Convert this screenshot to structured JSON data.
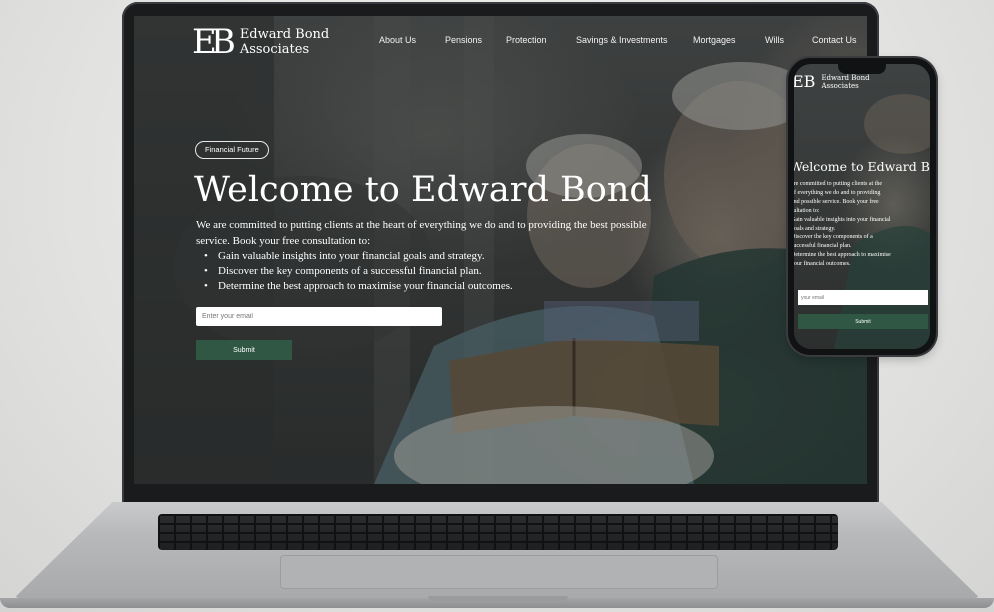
{
  "brand": {
    "logo_mark": "EB",
    "name_line1": "Edward Bond",
    "name_line2": "Associates"
  },
  "nav": {
    "items": [
      {
        "label": "About Us"
      },
      {
        "label": "Pensions"
      },
      {
        "label": "Protection"
      },
      {
        "label": "Savings & Investments"
      },
      {
        "label": "Mortgages"
      },
      {
        "label": "Wills"
      },
      {
        "label": "Contact Us"
      }
    ]
  },
  "hero": {
    "tag": "Financial Future",
    "title": "Welcome to Edward Bond",
    "description": "We are committed to putting clients at the heart of everything we do and to providing the best possible service. Book your free consultation to:",
    "bullets": [
      "Gain valuable insights into your financial goals and strategy.",
      "Discover the key components of a successful financial plan.",
      "Determine the best approach to maximise your financial outcomes."
    ],
    "email_placeholder": "Enter your email",
    "submit_label": "Submit"
  },
  "mobile": {
    "name_line1": "Edward Bond",
    "name_line2": "Associates",
    "title": "Welcome to Edward Bond",
    "description_lines": [
      "are committed to putting clients at the",
      "of everything we do and to providing",
      "and possible service. Book your free",
      "sultation to:",
      "Gain valuable insights into your financial",
      "goals and strategy.",
      "Discover the key components of a",
      "successful financial plan.",
      "Determine the best approach to maximise",
      "your financial outcomes."
    ],
    "email_placeholder": "your email",
    "submit_label": "Submit"
  },
  "colors": {
    "accent_green": "#2f5744",
    "text_white": "#ffffff",
    "device_dark": "#1a1b1d"
  }
}
